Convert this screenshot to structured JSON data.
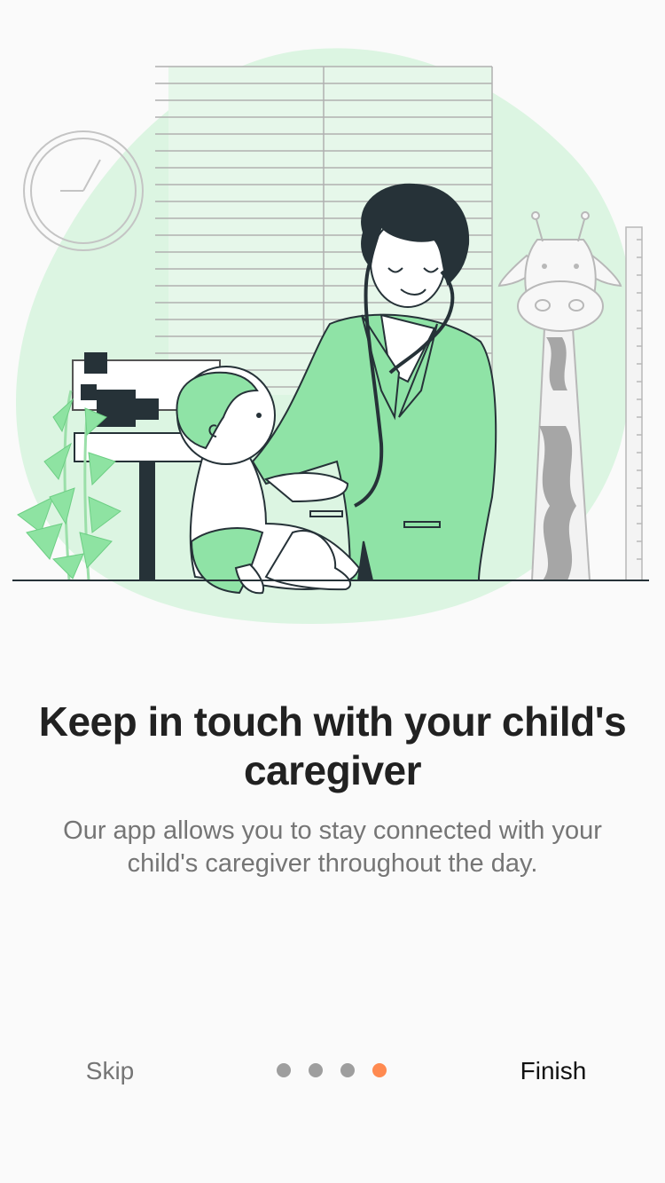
{
  "onboarding": {
    "title": "Keep in touch with your child's caregiver",
    "subtitle": "Our app allows you to stay connected with your child's caregiver throughout the day.",
    "illustration": "doctor-examining-baby-illustration"
  },
  "nav": {
    "skip_label": "Skip",
    "finish_label": "Finish",
    "page_count": 4,
    "current_page": 4
  },
  "colors": {
    "accent": "#ff8a50",
    "inactive_dot": "#9e9e9e",
    "blob": "#dcf5e2",
    "coat": "#8fe3a6"
  }
}
